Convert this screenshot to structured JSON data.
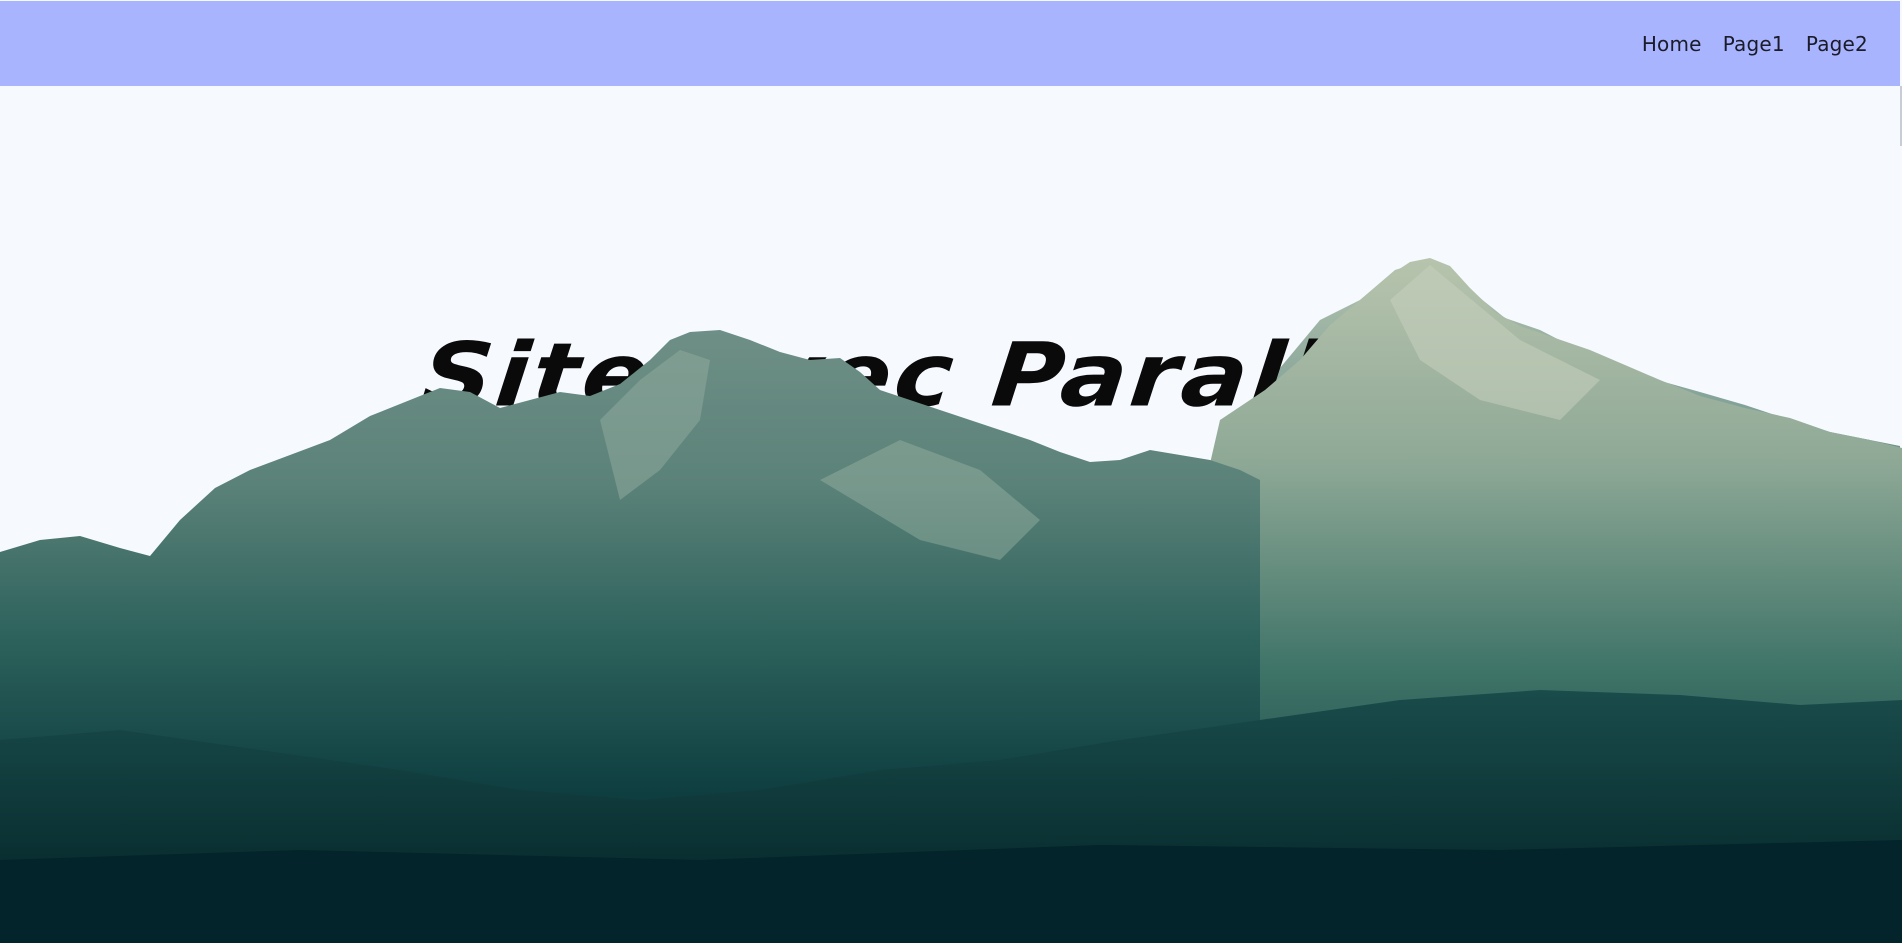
{
  "nav": {
    "items": [
      {
        "label": "Home"
      },
      {
        "label": "Page1"
      },
      {
        "label": "Page2"
      }
    ]
  },
  "hero": {
    "title": "Site avec Parallax"
  },
  "colors": {
    "navbar_bg": "#a8b4fd",
    "page_bg": "#f6f9fe",
    "mountain_dark": "#032a30",
    "mountain_mid": "#2f6b62",
    "mountain_light": "#b9c6b0"
  },
  "icons": []
}
